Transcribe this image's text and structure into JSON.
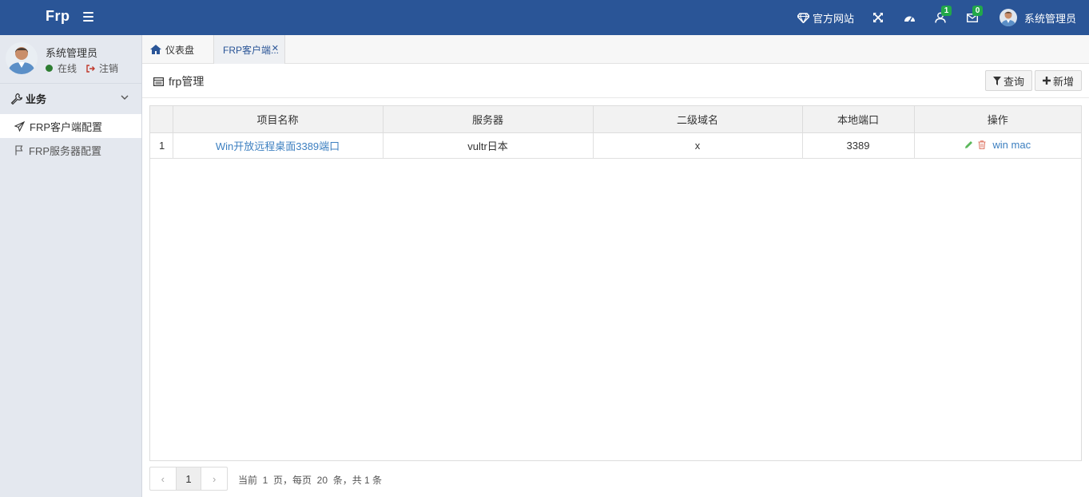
{
  "header": {
    "brand": "Frp",
    "official_site": "官方网站",
    "notifications_badge": "1",
    "messages_badge": "0",
    "user_name": "系统管理员",
    "colors": {
      "bar": "#2a5597",
      "badge": "#22a84a"
    }
  },
  "sidebar": {
    "user": {
      "name": "系统管理员",
      "status": "在线",
      "logout": "注销"
    },
    "group": {
      "label": "业务"
    },
    "items": [
      {
        "label": "FRP客户端配置",
        "active": true
      },
      {
        "label": "FRP服务器配置",
        "active": false
      }
    ]
  },
  "tabs": [
    {
      "label": "仪表盘"
    },
    {
      "label": "FRP客户端..."
    }
  ],
  "content": {
    "title": "frp管理",
    "query_button": "查询",
    "add_button": "新增"
  },
  "table": {
    "columns": [
      "",
      "项目名称",
      "服务器",
      "二级域名",
      "本地端口",
      "操作"
    ],
    "rows": [
      {
        "index": "1",
        "name": "Win开放远程桌面3389端口",
        "server": "vultr日本",
        "subdomain": "x",
        "local_port": "3389",
        "op_label": "win mac"
      }
    ]
  },
  "pager": {
    "prev": "‹",
    "current": "1",
    "next": "›",
    "info": "当前  1  页，每页  20  条，共 1 条"
  }
}
